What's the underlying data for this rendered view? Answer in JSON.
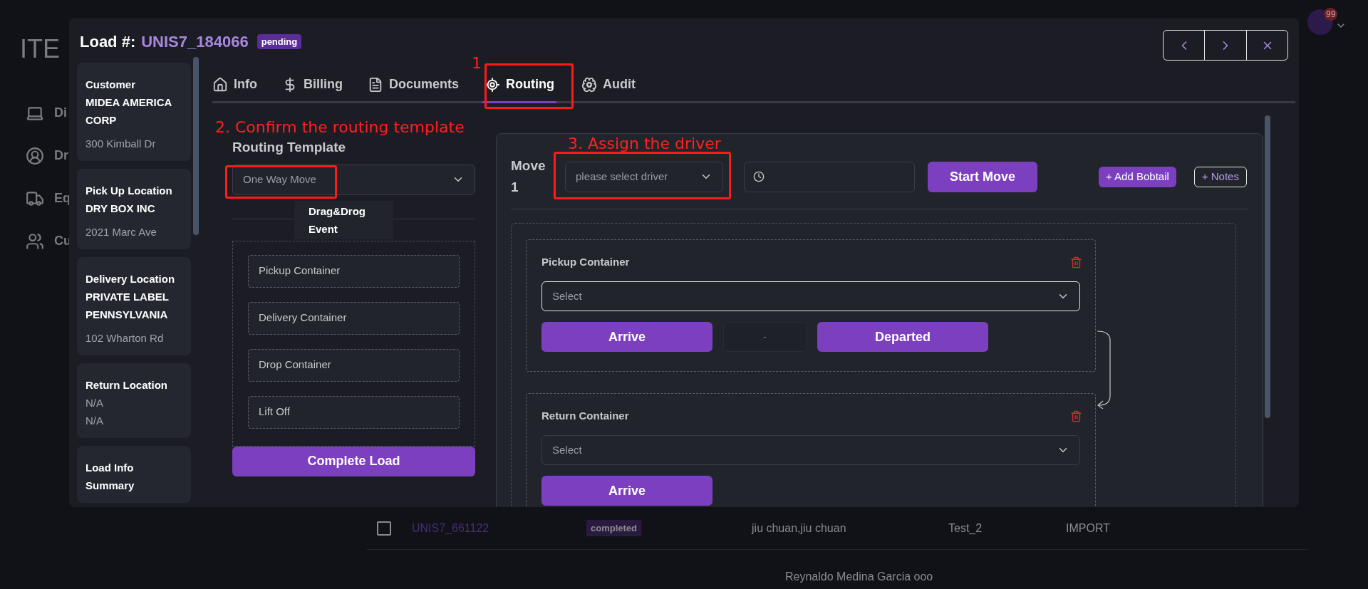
{
  "background_app": {
    "logo": "ITE",
    "nav": [
      {
        "label": "Di"
      },
      {
        "label": "Dr"
      },
      {
        "label": "Eq"
      },
      {
        "label": "Cu"
      }
    ],
    "notification_count": "99",
    "rows": [
      {
        "load": "UNIS7_661122",
        "status": "completed",
        "driver": "jiu chuan,jiu chuan",
        "column_4": "Test_2",
        "column_5": "IMPORT",
        "checked": false
      },
      {
        "driver": "Reynaldo Medina Garcia ooo"
      }
    ]
  },
  "modal": {
    "title_label": "Load #:",
    "load_number": "UNIS7_184066",
    "status": "pending",
    "summary_cards": [
      {
        "title": "Customer",
        "lines": [
          {
            "text": "MIDEA AMERICA CORP",
            "emphasis": true
          },
          {
            "text": "300 Kimball Dr",
            "emphasis": false
          }
        ]
      },
      {
        "title": "Pick Up Location",
        "lines": [
          {
            "text": "DRY BOX INC",
            "emphasis": true
          },
          {
            "text": "2021 Marc Ave",
            "emphasis": false
          }
        ]
      },
      {
        "title": "Delivery Location",
        "lines": [
          {
            "text": "PRIVATE LABEL PENNSYLVANIA",
            "emphasis": true
          },
          {
            "text": "102 Wharton Rd",
            "emphasis": false
          }
        ]
      },
      {
        "title": "Return Location",
        "lines": [
          {
            "text": "N/A",
            "emphasis": false
          },
          {
            "text": "N/A",
            "emphasis": false
          }
        ]
      },
      {
        "title": "Load Info Summary"
      }
    ],
    "tabs": [
      {
        "label": "Info",
        "selected": false
      },
      {
        "label": "Billing",
        "selected": false
      },
      {
        "label": "Documents",
        "selected": false
      },
      {
        "label": "Routing",
        "selected": true
      },
      {
        "label": "Audit",
        "selected": false
      }
    ],
    "routing_template": {
      "title": "Routing Template",
      "value": "One Way Move",
      "popup": "Drag&Drog Event",
      "events": [
        "Pickup Container",
        "Delivery Container",
        "Drop Container",
        "Lift Off"
      ],
      "complete_button": "Complete Load"
    },
    "move": {
      "title": "Move 1",
      "driver_placeholder": "please select driver",
      "start_button": "Start Move",
      "add_bobtail_button": "+ Add Bobtail",
      "notes_button": "+ Notes",
      "events": [
        {
          "title": "Pickup Container",
          "select_placeholder": "Select",
          "focused": true,
          "actions": [
            {
              "kind": "button",
              "label": "Arrive"
            },
            {
              "kind": "time",
              "label": "-"
            },
            {
              "kind": "button",
              "label": "Departed"
            }
          ]
        },
        {
          "title": "Return Container",
          "select_placeholder": "Select",
          "focused": false,
          "actions": [
            {
              "kind": "button",
              "label": "Arrive"
            }
          ]
        }
      ]
    }
  },
  "annotations": [
    {
      "text": "1"
    },
    {
      "text": "2. Confirm the routing template"
    },
    {
      "text": "3. Assign the driver"
    }
  ]
}
